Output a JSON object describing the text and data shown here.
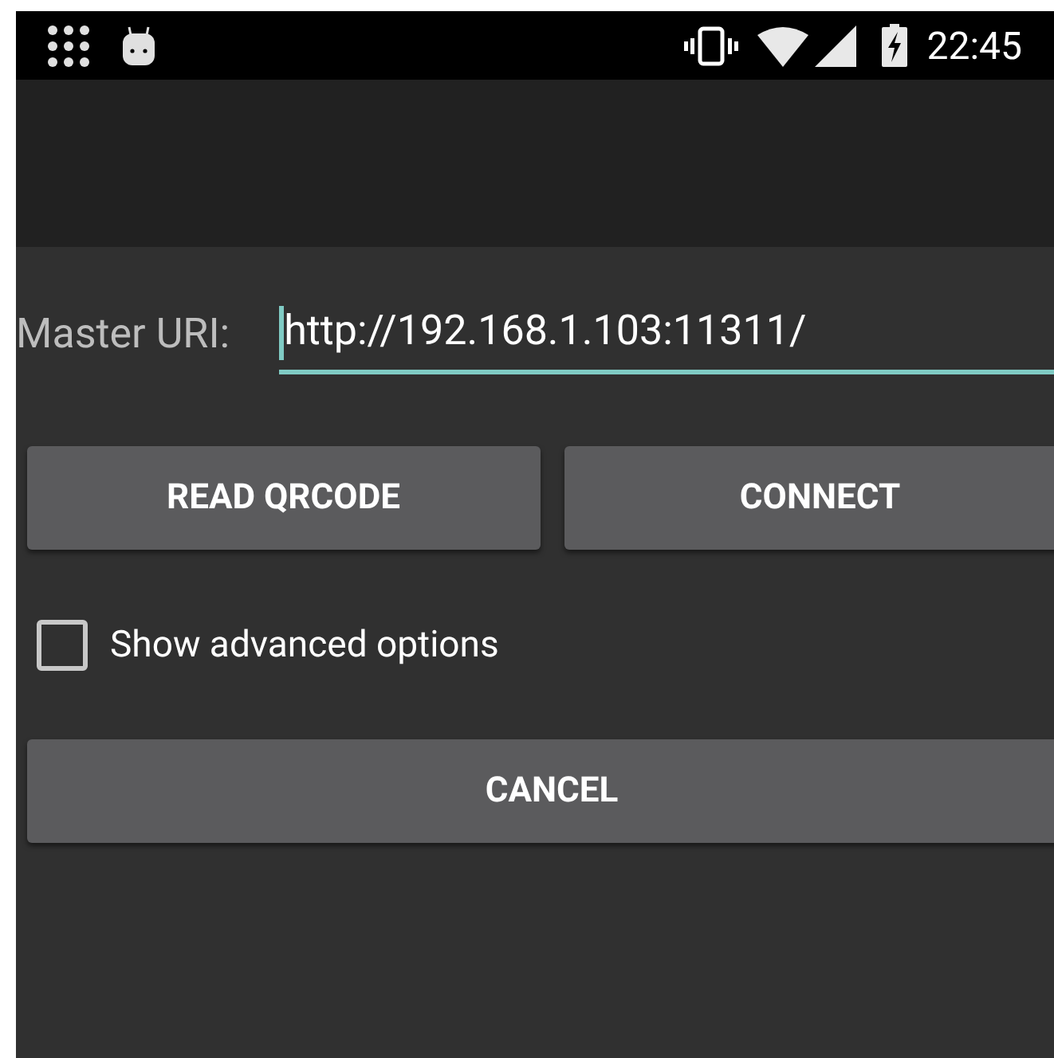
{
  "status_bar": {
    "time": "22:45"
  },
  "form": {
    "label": "Master URI:",
    "uri": "http://192.168.1.103:11311/",
    "focused": true
  },
  "buttons": [
    "READ QRCODE",
    "CONNECT"
  ],
  "advanced_options": {
    "label": "Show advanced options",
    "checked": false
  },
  "cancel_button": "CANCEL"
}
